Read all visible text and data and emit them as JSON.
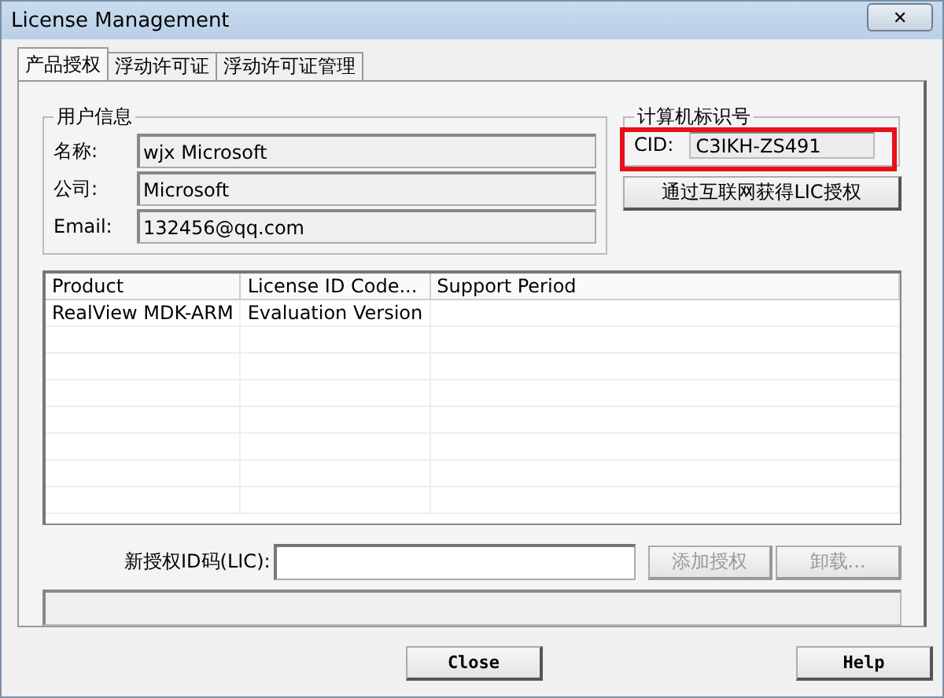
{
  "window": {
    "title": "License Management",
    "close_glyph": "✕"
  },
  "tabs": [
    {
      "label": "产品授权",
      "selected": true
    },
    {
      "label": "浮动许可证",
      "selected": false
    },
    {
      "label": "浮动许可证管理",
      "selected": false
    }
  ],
  "user_info": {
    "title": "用户信息",
    "fields": [
      {
        "label": "名称:",
        "value": "wjx Microsoft"
      },
      {
        "label": "公司:",
        "value": "Microsoft"
      },
      {
        "label": "Email:",
        "value": "132456@qq.com"
      }
    ]
  },
  "computer_id": {
    "title": "计算机标识号",
    "label": "CID:",
    "value": "C3IKH-ZS491",
    "highlighted": true
  },
  "internet_button": {
    "label": "通过互联网获得LIC授权",
    "disabled": false
  },
  "table": {
    "columns": [
      "Product",
      "License ID Code...",
      "Support Period"
    ],
    "rows": [
      [
        "RealView MDK-ARM",
        "Evaluation Version",
        null
      ]
    ]
  },
  "new_license": {
    "label": "新授权ID码(LIC):"
  },
  "add_button": {
    "label": "添加授权",
    "disabled": true
  },
  "uninstall_button": {
    "label": "卸载...",
    "disabled": true
  },
  "buttons": [
    {
      "label": "Close"
    },
    {
      "label": "Help"
    }
  ]
}
